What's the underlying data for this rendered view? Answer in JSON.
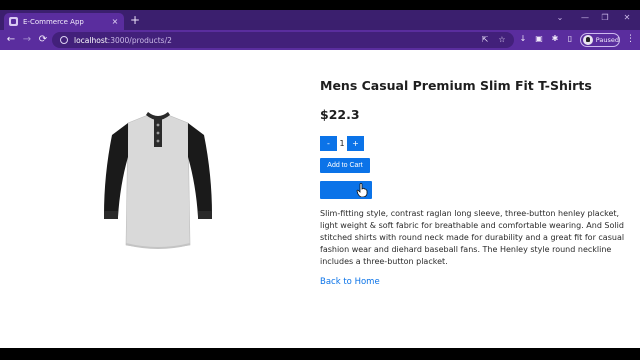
{
  "browser": {
    "tab": {
      "title": "E-Commerce App",
      "close_glyph": "×",
      "favicon": "app-icon"
    },
    "new_tab_glyph": "+",
    "window_controls": [
      "⌄",
      "—",
      "❐",
      "✕"
    ],
    "nav": {
      "back": "←",
      "forward": "→",
      "reload": "⟳"
    },
    "url_host": "localhost",
    "url_path": ":3000/products/2",
    "omnibox_icons": {
      "share": "⇱",
      "bookmark": "☆"
    },
    "extension_icons": [
      "↓",
      "▣",
      "✱",
      "▯"
    ],
    "profile_label": "Paused",
    "menu_glyph": "⋮"
  },
  "product": {
    "title": "Mens Casual Premium Slim Fit T-Shirts",
    "price": "$22.3",
    "quantity": "1",
    "decrement_label": "-",
    "increment_label": "+",
    "add_to_cart_label": "Add to Cart",
    "description": "Slim-fitting style, contrast raglan long sleeve, three-button henley placket, light weight & soft fabric for breathable and comfortable wearing. And Solid stitched shirts with round neck made for durability and a great fit for casual fashion wear and diehard baseball fans. The Henley style round neckline includes a three-button placket.",
    "back_link": "Back to Home"
  },
  "colors": {
    "tab_strip": "#3b1f6e",
    "toolbar": "#5a2d9e",
    "primary_button": "#0b73e8",
    "link": "#0b73e8"
  }
}
